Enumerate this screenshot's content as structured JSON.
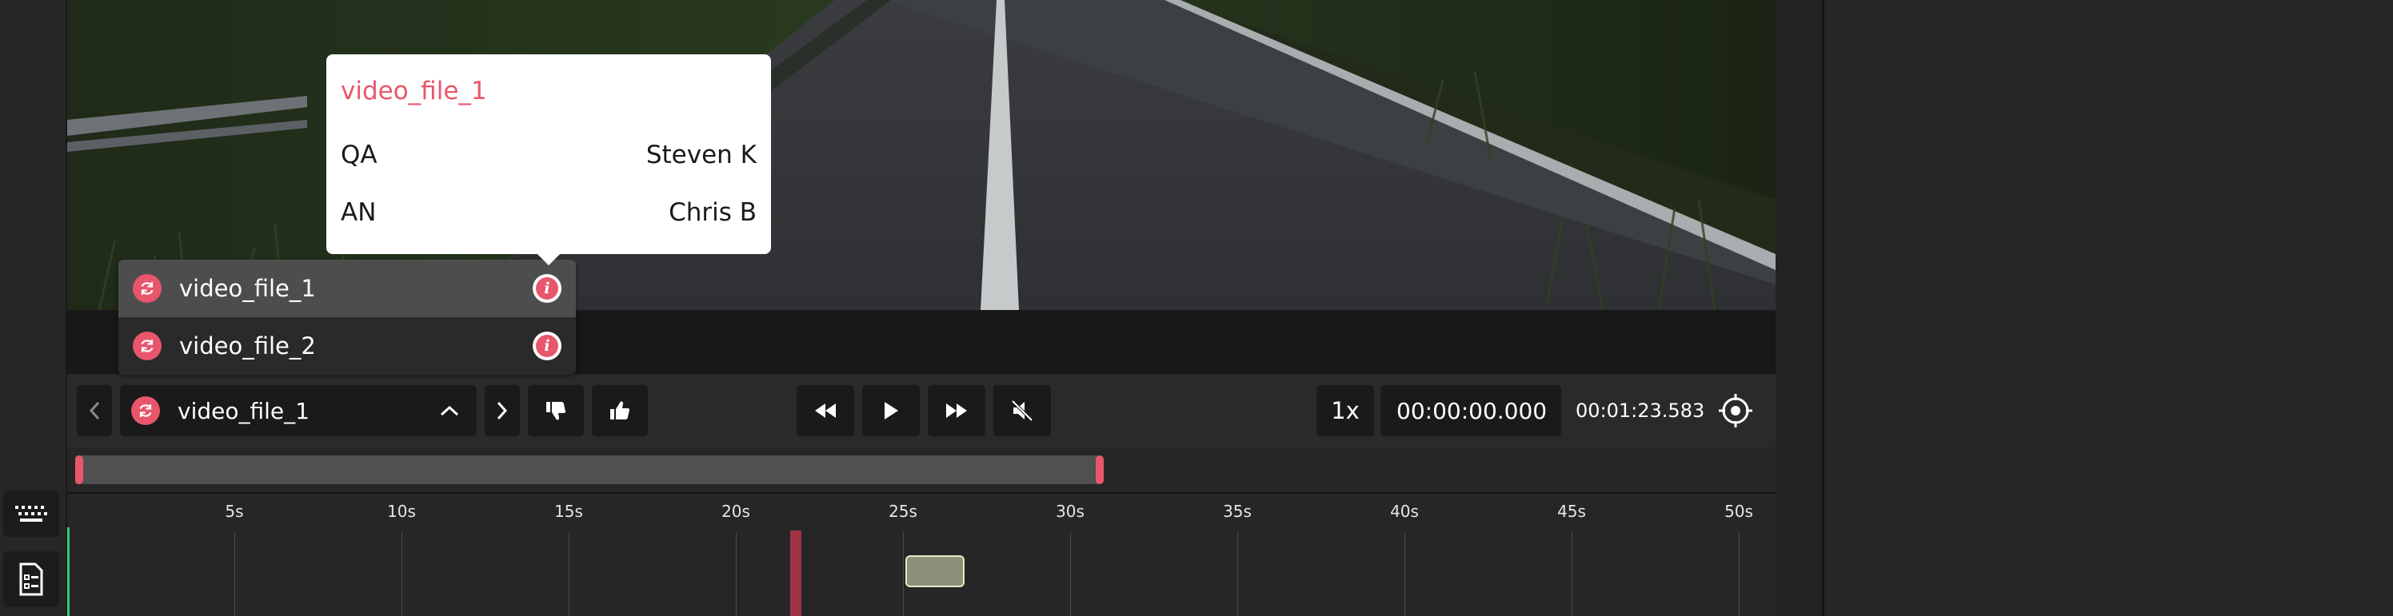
{
  "popover": {
    "title": "video_file_1",
    "rows": [
      {
        "key": "QA",
        "value": "Steven K"
      },
      {
        "key": "AN",
        "value": "Chris B"
      }
    ]
  },
  "file_menu": {
    "items": [
      {
        "label": "video_file_1",
        "selected": true
      },
      {
        "label": "video_file_2",
        "selected": false
      }
    ]
  },
  "controls": {
    "current_file": "video_file_1",
    "speed": "1x",
    "current_time": "00:00:00.000",
    "duration": "00:01:23.583"
  },
  "timeline": {
    "ticks": [
      "5s",
      "10s",
      "15s",
      "20s",
      "25s",
      "30s",
      "35s",
      "40s",
      "45s",
      "50s"
    ]
  },
  "icons": {
    "left_rail": [
      "keyboard-icon",
      "checklist-icon"
    ],
    "controls": [
      "chevron-left-icon",
      "sync-icon",
      "chevron-up-icon",
      "chevron-right-icon",
      "thumbs-down-icon",
      "thumbs-up-icon",
      "rewind-icon",
      "play-icon",
      "fast-forward-icon",
      "mute-icon",
      "crosshair-icon"
    ]
  },
  "colors": {
    "accent": "#e8566b",
    "playhead": "#9e3444",
    "range_fill": "#505050",
    "clip_fill": "#8d9179",
    "clip_border": "#e9e8c7",
    "timeline_start": "#2ecc71"
  }
}
